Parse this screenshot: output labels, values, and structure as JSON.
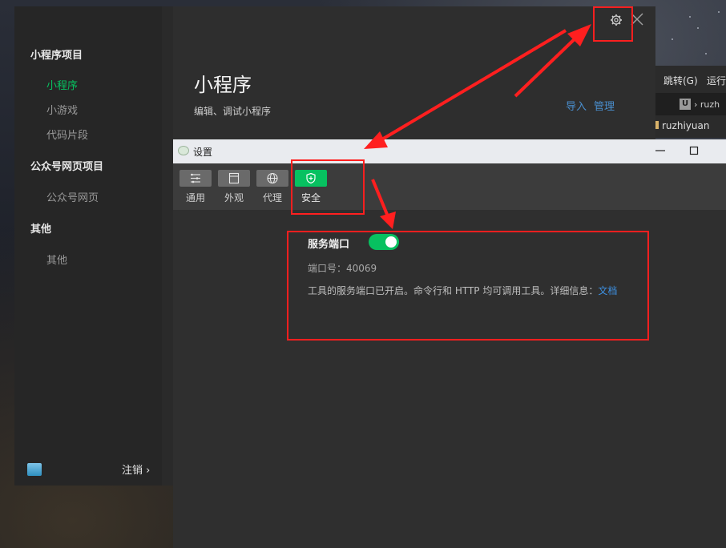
{
  "launcher": {
    "sidebar": {
      "groups": [
        {
          "title": "小程序项目",
          "items": [
            "小程序",
            "小游戏",
            "代码片段"
          ]
        },
        {
          "title": "公众号网页项目",
          "items": [
            "公众号网页"
          ]
        },
        {
          "title": "其他",
          "items": [
            "其他"
          ]
        }
      ],
      "active_item": "小程序",
      "logout_label": "注销 ›"
    },
    "main": {
      "title": "小程序",
      "subtitle": "编辑、调试小程序",
      "import_label": "导入",
      "manage_label": "管理"
    },
    "header_icons": [
      "gear-icon",
      "close-icon"
    ]
  },
  "background_ide": {
    "menu": [
      "跳转(G)",
      "运行"
    ],
    "breadcrumb": "ruzh",
    "folder": "ruzhiyuan"
  },
  "settings_dialog": {
    "title": "设置",
    "tabs": [
      {
        "label": "通用",
        "icon": "list-settings-icon"
      },
      {
        "label": "外观",
        "icon": "window-icon"
      },
      {
        "label": "代理",
        "icon": "globe-icon"
      },
      {
        "label": "安全",
        "icon": "shield-icon"
      }
    ],
    "active_tab": "安全",
    "service_port": {
      "label": "服务端口",
      "enabled": true,
      "port_text": "端口号：40069",
      "description": "工具的服务端口已开启。命令行和 HTTP 均可调用工具。详细信息：",
      "doc_link": "文档"
    }
  },
  "colors": {
    "accent_green": "#07c160",
    "annotation_red": "#ff1f1f",
    "link_blue": "#3d8fe0"
  }
}
